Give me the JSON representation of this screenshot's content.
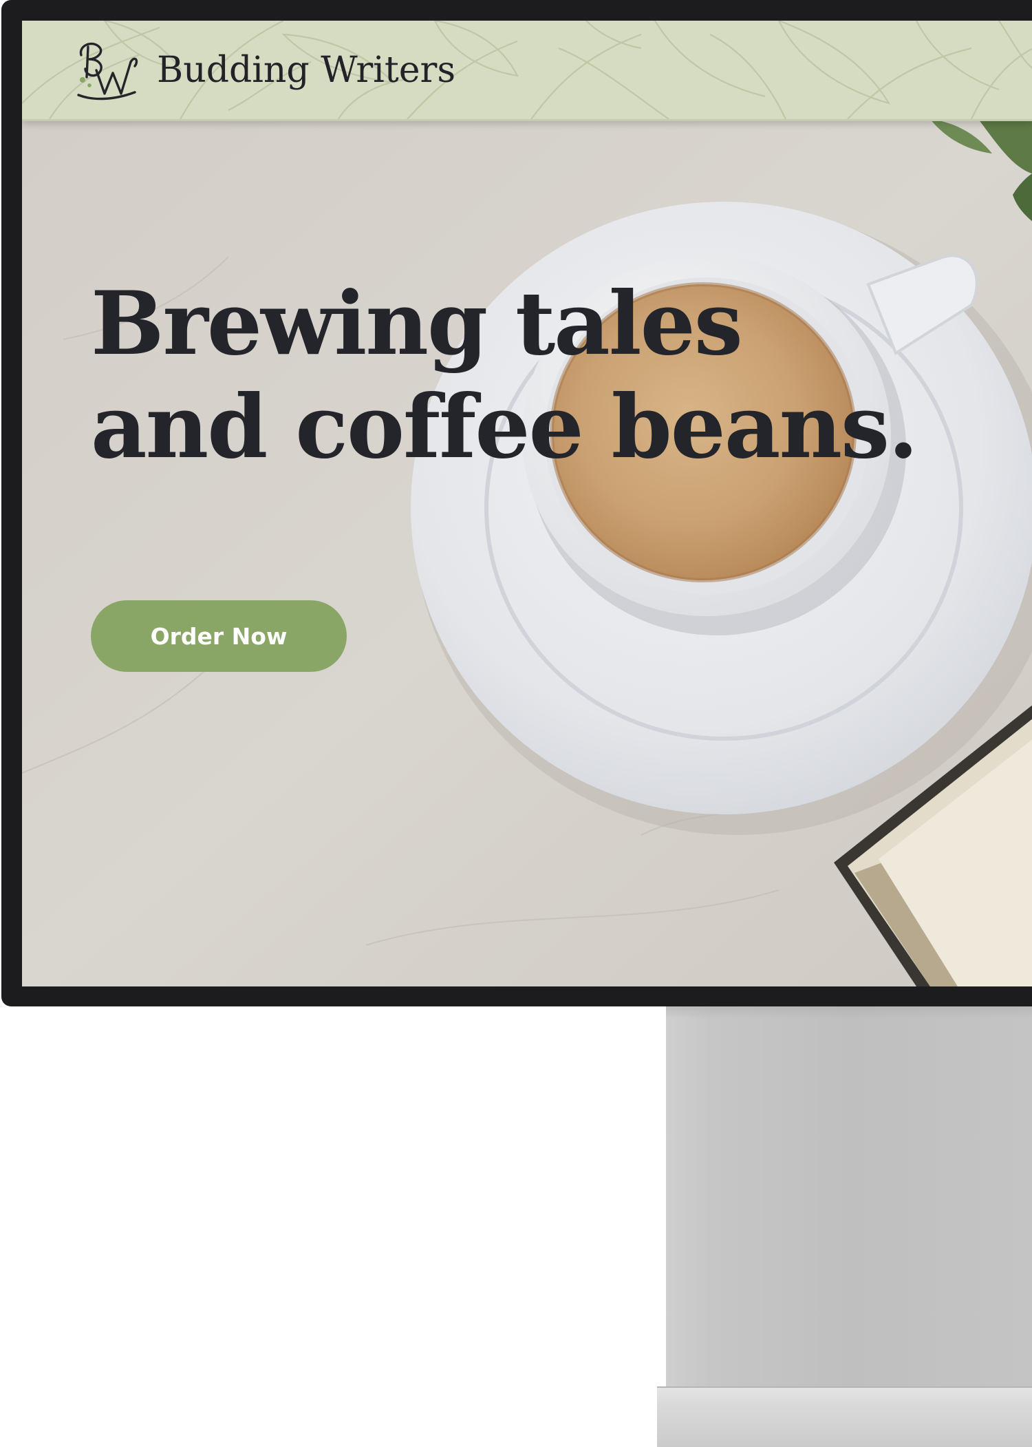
{
  "brand": {
    "name": "Budding Writers",
    "logo_icon": "bw-monogram-logo"
  },
  "hero": {
    "headline_line1": "Brewing tales",
    "headline_line2": "and coffee beans.",
    "cta_label": "Order Now",
    "image_subject": "coffee-cup-on-saucer-with-book"
  },
  "colors": {
    "header_bg": "#d5dcc1",
    "cta_bg": "#8aa666",
    "headline_text": "#24252b",
    "bezel": "#1c1c1e"
  }
}
